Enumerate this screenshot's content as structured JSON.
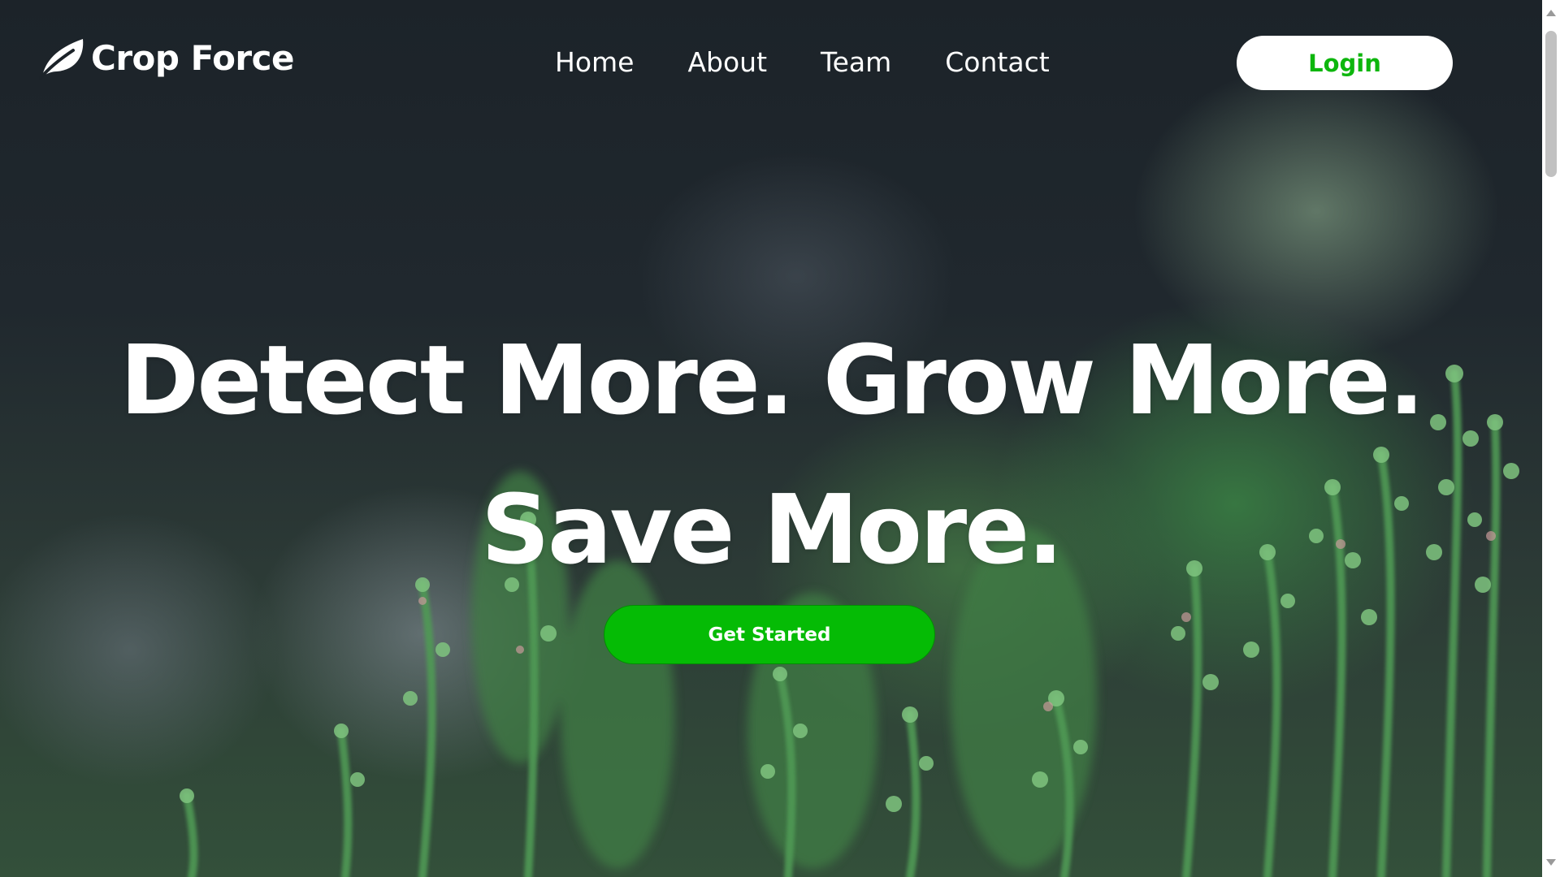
{
  "brand": {
    "name": "Crop Force",
    "icon": "leaf-icon"
  },
  "nav": {
    "links": [
      {
        "label": "Home"
      },
      {
        "label": "About"
      },
      {
        "label": "Team"
      },
      {
        "label": "Contact"
      }
    ],
    "login_label": "Login"
  },
  "hero": {
    "headline_line1": "Detect More. Grow More.",
    "headline_line2": "Save More.",
    "cta_label": "Get Started"
  },
  "colors": {
    "accent_green": "#05bb05",
    "login_text": "#0db60d",
    "text_white": "#ffffff"
  }
}
